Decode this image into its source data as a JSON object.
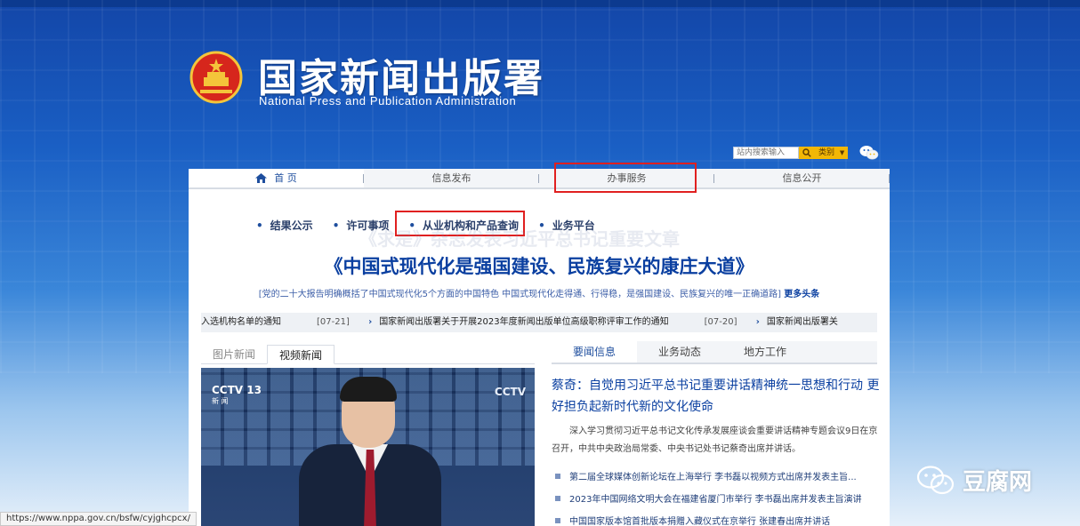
{
  "header": {
    "title": "国家新闻出版署",
    "subtitle": "National Press and Publication Administration"
  },
  "search": {
    "placeholder": "站内搜索输入",
    "category": "类别"
  },
  "nav": [
    {
      "label": "首 页"
    },
    {
      "label": "信息发布"
    },
    {
      "label": "办事服务"
    },
    {
      "label": "信息公开"
    }
  ],
  "subnav": [
    {
      "label": "结果公示"
    },
    {
      "label": "许可事项"
    },
    {
      "label": "从业机构和产品查询"
    },
    {
      "label": "业务平台"
    }
  ],
  "headline": {
    "ghost": "《求是》杂志发表习近平总书记重要文章",
    "main": "《中国式现代化是强国建设、民族复兴的康庄大道》",
    "summary": "[党的二十大报告明确概括了中国式现代化5个方面的中国特色 中国式现代化走得通、行得稳，是强国建设、民族复兴的唯一正确道路]",
    "more": "更多头条"
  },
  "ticker": [
    {
      "text": "入选机构名单的通知",
      "date": "[07-21]"
    },
    {
      "text": "国家新闻出版署关于开展2023年度新闻出版单位高级职称评审工作的通知",
      "date": "[07-20]"
    },
    {
      "text": "国家新闻出版署关",
      "date": ""
    }
  ],
  "left_tabs": [
    {
      "label": "图片新闻"
    },
    {
      "label": "视频新闻"
    }
  ],
  "video": {
    "channel": "CCTV 13",
    "channel_sub": "新 闻",
    "logo_right": "CCTV"
  },
  "right_tabs": [
    {
      "label": "要闻信息"
    },
    {
      "label": "业务动态"
    },
    {
      "label": "地方工作"
    }
  ],
  "top_news": {
    "title": "蔡奇：自觉用习近平总书记重要讲话精神统一思想和行动 更好担负起新时代新的文化使命",
    "summary": "深入学习贯彻习近平总书记文化传承发展座谈会重要讲话精神专题会议9日在京召开，中共中央政治局常委、中央书记处书记蔡奇出席并讲话。"
  },
  "news_list": [
    {
      "text": "第二届全球媒体创新论坛在上海举行 李书磊以视频方式出席并发表主旨..."
    },
    {
      "text": "2023年中国网络文明大会在福建省厦门市举行 李书磊出席并发表主旨演讲"
    },
    {
      "text": "中国国家版本馆首批版本捐赠入藏仪式在京举行 张建春出席并讲话"
    }
  ],
  "watermark": {
    "text": "豆腐网"
  },
  "status_url": "https://www.nppa.gov.cn/bsfw/cyjghcpcx/",
  "colors": {
    "accent": "#0a3fa0",
    "highlight_box": "#e02020",
    "search_button": "#f2b705"
  }
}
